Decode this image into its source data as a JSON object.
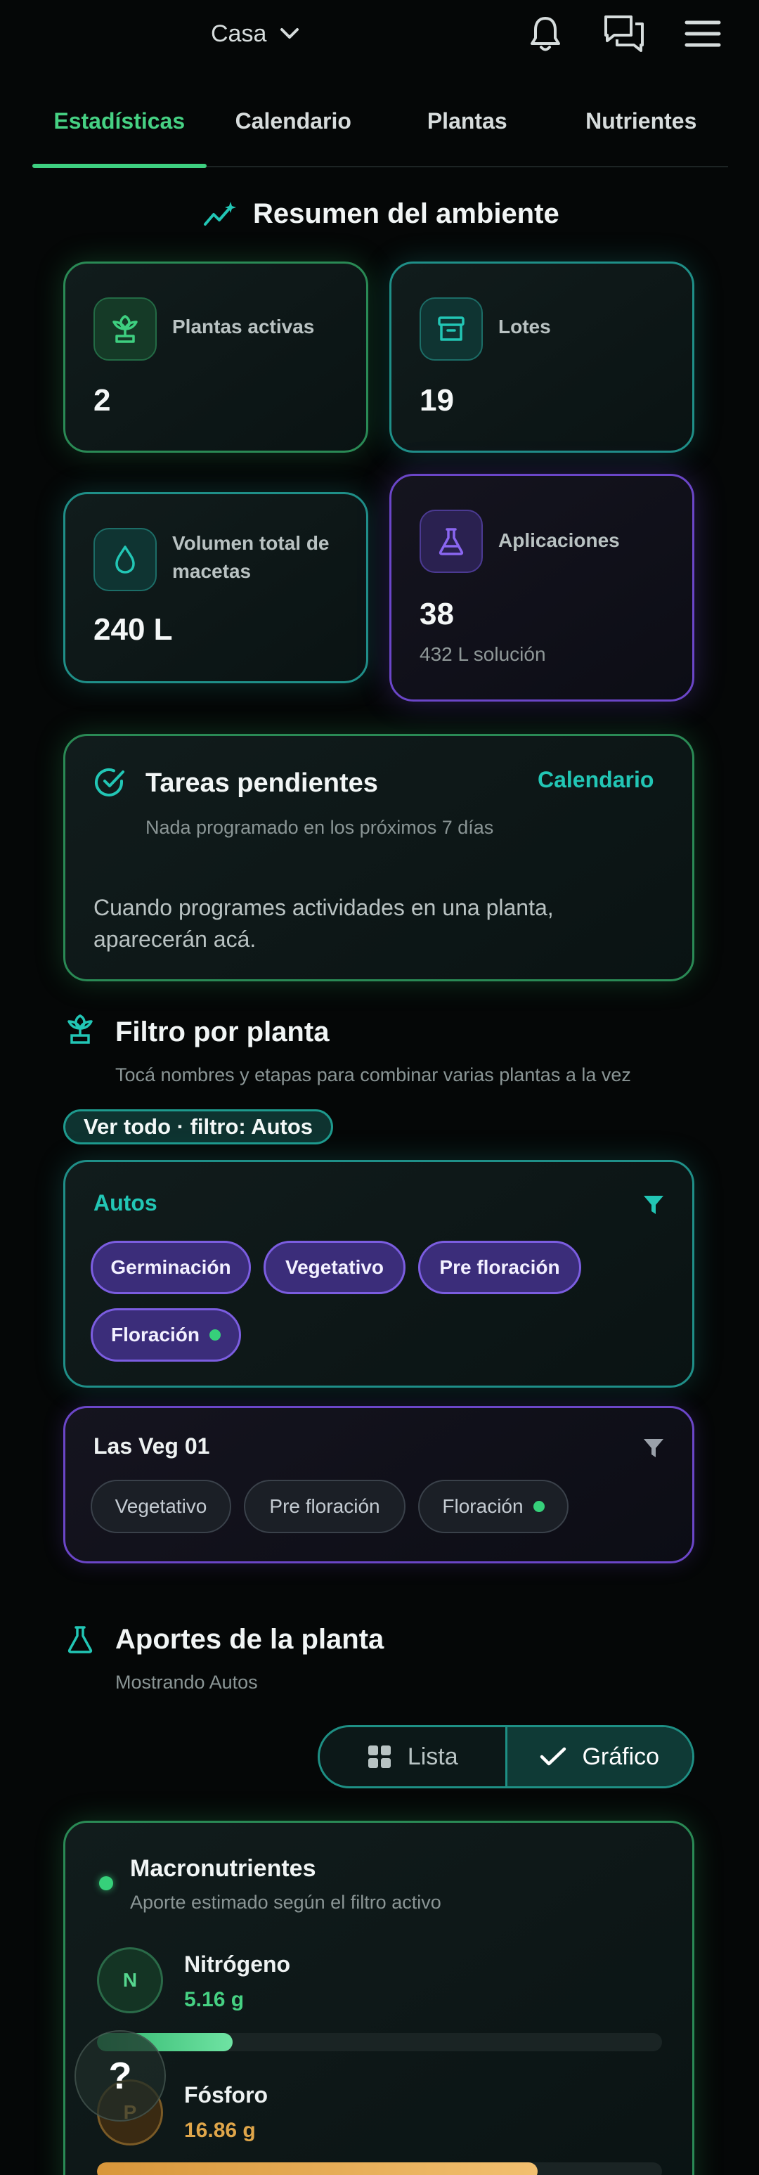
{
  "header": {
    "environment": "Casa",
    "icons": [
      "chevron-down-icon",
      "bell-icon",
      "chat-icon",
      "menu-icon"
    ]
  },
  "tabs": [
    {
      "label": "Estadísticas",
      "active": true
    },
    {
      "label": "Calendario",
      "active": false
    },
    {
      "label": "Plantas",
      "active": false
    },
    {
      "label": "Nutrientes",
      "active": false
    }
  ],
  "summary": {
    "title": "Resumen del ambiente",
    "cards": [
      {
        "label": "Plantas activas",
        "value": "2",
        "icon": "plant-icon",
        "accent": "#3ecf80"
      },
      {
        "label": "Lotes",
        "value": "19",
        "icon": "archive-icon",
        "accent": "#22b8ad"
      },
      {
        "label": "Volumen total de macetas",
        "value": "240 L",
        "icon": "drop-icon",
        "accent": "#22b8ad"
      },
      {
        "label": "Aplicaciones",
        "value": "38",
        "sub": "432 L solución",
        "icon": "flask-icon",
        "accent": "#8a66f0"
      }
    ]
  },
  "tasks": {
    "title": "Tareas pendientes",
    "link": "Calendario",
    "subtitle": "Nada programado en los próximos 7 días",
    "empty_message": "Cuando programes actividades en una planta, aparecerán acá."
  },
  "filter": {
    "title": "Filtro por planta",
    "subtitle": "Tocá nombres y etapas para combinar varias plantas a la vez",
    "active_pill": "Ver todo · filtro: Autos",
    "plants": [
      {
        "name": "Autos",
        "selected": true,
        "stages": [
          {
            "label": "Germinación",
            "current": false
          },
          {
            "label": "Vegetativo",
            "current": false
          },
          {
            "label": "Pre floración",
            "current": false
          },
          {
            "label": "Floración",
            "current": true
          }
        ]
      },
      {
        "name": "Las Veg 01",
        "selected": false,
        "stages": [
          {
            "label": "Vegetativo",
            "current": false
          },
          {
            "label": "Pre floración",
            "current": false
          },
          {
            "label": "Floración",
            "current": true
          }
        ]
      }
    ]
  },
  "contributions": {
    "title": "Aportes de la planta",
    "subtitle": "Mostrando Autos",
    "view_toggle": [
      {
        "label": "Lista",
        "active": false
      },
      {
        "label": "Gráfico",
        "active": true
      }
    ],
    "macro": {
      "title": "Macronutrientes",
      "subtitle": "Aporte estimado según el filtro activo",
      "nutrients": [
        {
          "symbol": "N",
          "name": "Nitrógeno",
          "value": "5.16 g",
          "fill_fraction": 0.24,
          "color": "#3ecf80"
        },
        {
          "symbol": "P",
          "name": "Fósforo",
          "value": "16.86 g",
          "fill_fraction": 0.78,
          "color": "#e0a64a"
        }
      ]
    },
    "help_symbol": "?"
  }
}
